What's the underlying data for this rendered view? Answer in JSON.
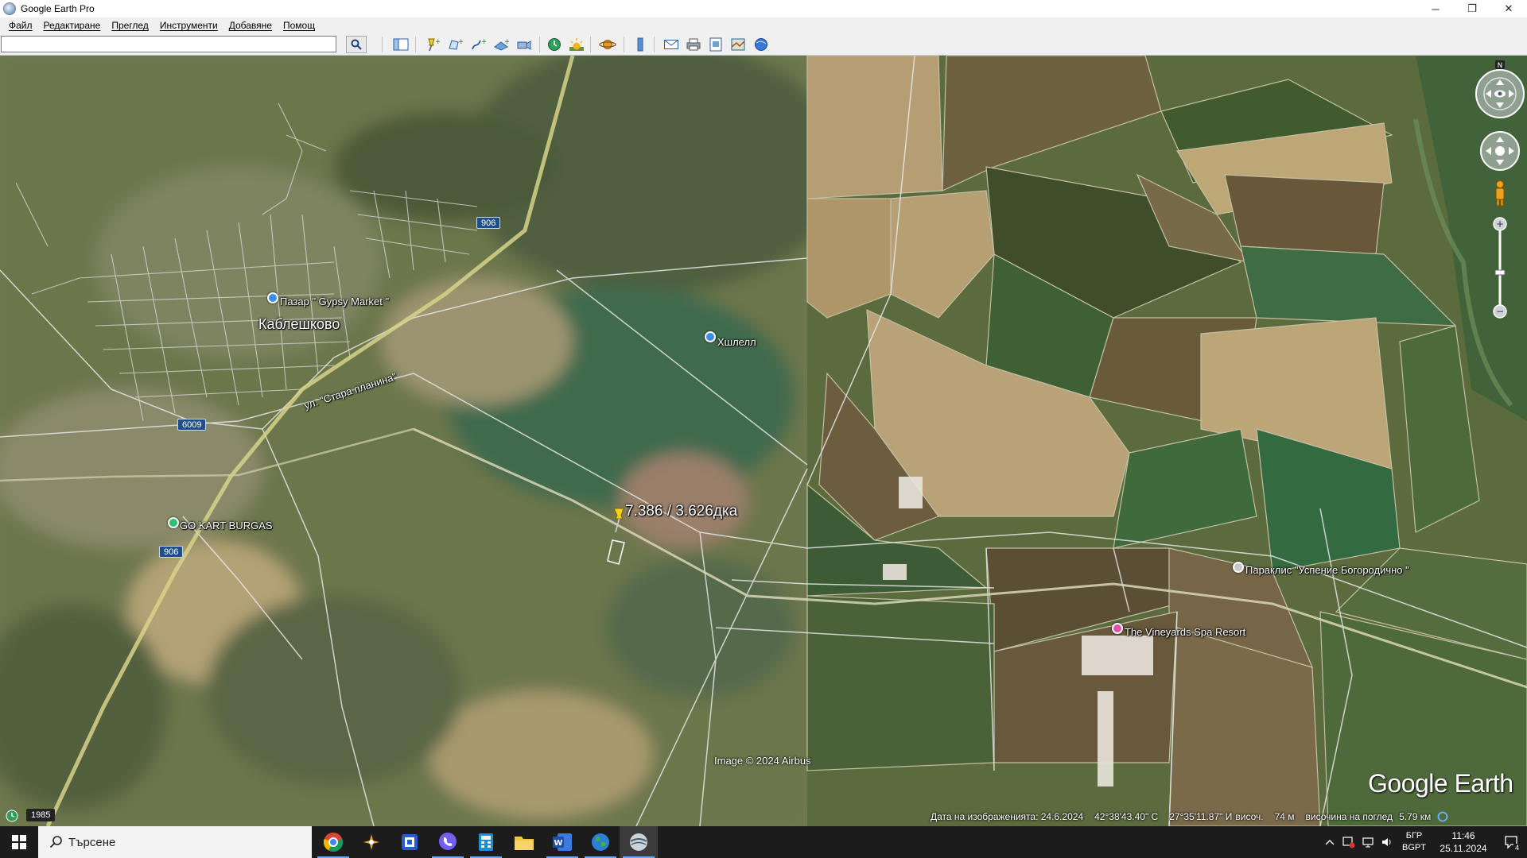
{
  "window": {
    "title": "Google Earth Pro",
    "controls": {
      "minimize": "─",
      "restore": "❐",
      "close": "✕"
    }
  },
  "menu": {
    "items": [
      "Файл",
      "Редактиране",
      "Преглед",
      "Инструменти",
      "Добавяне",
      "Помощ"
    ]
  },
  "toolbar": {
    "search_value": "",
    "icons": [
      "sidebar-toggle-icon",
      "add-placemark-icon",
      "add-polygon-icon",
      "add-path-icon",
      "add-image-overlay-icon",
      "record-tour-icon",
      "historical-imagery-icon",
      "sun-icon",
      "planets-icon",
      "ruler-icon",
      "email-icon",
      "print-icon",
      "save-image-icon",
      "view-in-maps-icon",
      "sign-in-icon"
    ]
  },
  "map": {
    "places": [
      {
        "name": "Каблешково"
      }
    ],
    "pois": [
      {
        "name": "Пазар \" Gypsy Market \"",
        "color": "#3b8ee8"
      },
      {
        "name": "Хшлелл",
        "color": "#3b8ee8"
      },
      {
        "name": "GO KART BURGAS",
        "color": "#2fbf71"
      },
      {
        "name": "Параклис \"Успение Богородично \"",
        "color": "#c8c8c8"
      },
      {
        "name": "The Vineyards Spa Resort",
        "color": "#e64fa8"
      }
    ],
    "measure_label": "7.386 / 3.626дка",
    "roads": {
      "badge_906_a": "906",
      "badge_906_b": "906",
      "badge_6009": "6009",
      "street": "ул. \"Стара планина\""
    },
    "compass_north": "N",
    "copyright": "Image © 2024 Airbus",
    "logo": "Google Earth",
    "historical_year": "1985"
  },
  "status": {
    "imagery_date": "Дата на изображенията: 24.6.2024",
    "lat": "42°38'43.40\" С",
    "lon": "27°35'11.87\" И",
    "elev_label": "височ.",
    "elev_value": "74 м",
    "eye_label": "височина на поглед",
    "eye_value": "5.79 км"
  },
  "taskbar": {
    "search_placeholder": "Търсене",
    "apps": [
      "chrome-icon",
      "paint-tool-icon",
      "network-app-icon",
      "viber-icon",
      "calculator-icon",
      "file-explorer-icon",
      "word-icon",
      "earth-globe-icon",
      "google-earth-pro-icon"
    ],
    "lang_top": "БГР",
    "lang_bottom": "BGPT",
    "time": "11:46",
    "date": "25.11.2024",
    "notification_count": "4"
  },
  "colors": {
    "accent": "#1f4f8a",
    "pin_yellow": "#f3d21a",
    "taskbar": "#1c1c1c"
  }
}
